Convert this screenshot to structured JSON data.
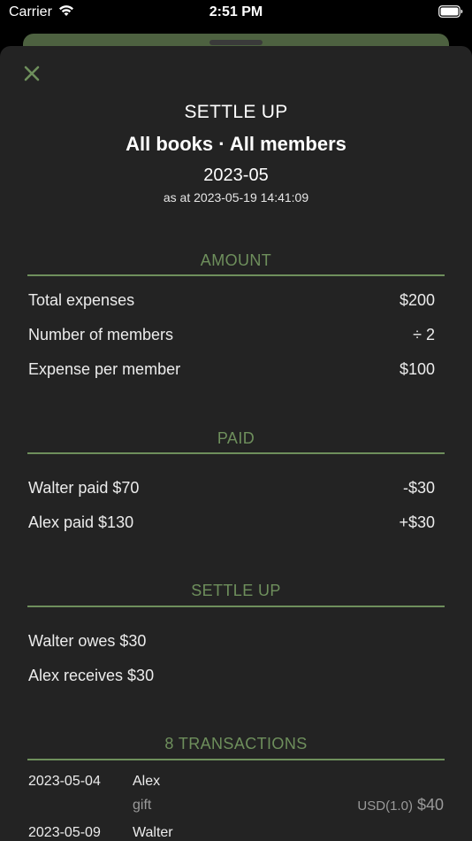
{
  "status_bar": {
    "carrier": "Carrier",
    "time": "2:51 PM"
  },
  "header": {
    "title": "SETTLE UP",
    "scope": "All books · All members",
    "period": "2023-05",
    "as_at": "as at 2023-05-19 14:41:09"
  },
  "amount": {
    "header": "AMOUNT",
    "rows": [
      {
        "label": "Total expenses",
        "value": "$200"
      },
      {
        "label": "Number of members",
        "value": "÷ 2"
      },
      {
        "label": "Expense per member",
        "value": "$100"
      }
    ]
  },
  "paid": {
    "header": "PAID",
    "rows": [
      {
        "label": "Walter paid $70",
        "value": "-$30"
      },
      {
        "label": "Alex paid $130",
        "value": "+$30"
      }
    ]
  },
  "settle": {
    "header": "SETTLE UP",
    "rows": [
      {
        "label": "Walter owes $30"
      },
      {
        "label": "Alex receives $30"
      }
    ]
  },
  "transactions": {
    "header": "8 TRANSACTIONS",
    "items": [
      {
        "date": "2023-05-04",
        "name": "Alex",
        "note": "gift",
        "currency": "USD(1.0)",
        "amount": "$40"
      },
      {
        "date": "2023-05-09",
        "name": "Walter"
      }
    ]
  },
  "colors": {
    "accent": "#6e8f5c",
    "sheet": "#232323",
    "behind_card": "#4d6140"
  },
  "icons": {
    "close": "close-icon",
    "wifi": "wifi-icon",
    "battery": "battery-icon"
  }
}
